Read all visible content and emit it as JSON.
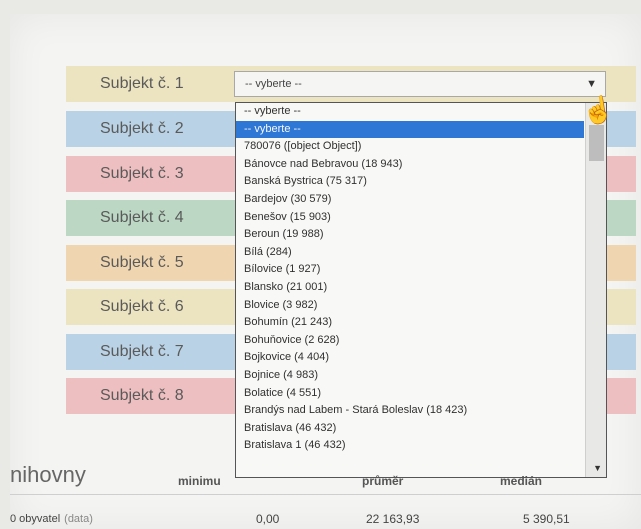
{
  "subjects": [
    {
      "label": "Subjekt č. 1",
      "color": "#ece3c0"
    },
    {
      "label": "Subjekt č. 2",
      "color": "#b9d2e5"
    },
    {
      "label": "Subjekt č. 3",
      "color": "#eebfc0"
    },
    {
      "label": "Subjekt č. 4",
      "color": "#bcd8c4"
    },
    {
      "label": "Subjekt č. 5",
      "color": "#f0d6b0"
    },
    {
      "label": "Subjekt č. 6",
      "color": "#ece3c0"
    },
    {
      "label": "Subjekt č. 7",
      "color": "#b9d2e5"
    },
    {
      "label": "Subjekt č. 8",
      "color": "#eebfc0"
    }
  ],
  "select": {
    "value": "-- vyberte --",
    "arrow_icon": "chevron-down-icon"
  },
  "dropdown": {
    "options": [
      "-- vyberte --",
      "-- vyberte --",
      "780076 ([object Object])",
      "Bánovce nad Bebravou (18 943)",
      "Banská Bystrica (75 317)",
      "Bardejov (30 579)",
      "Benešov (15 903)",
      "Beroun (19 988)",
      "Bílá (284)",
      "Bílovice (1 927)",
      "Blansko (21 001)",
      "Blovice (3 982)",
      "Bohumín (21 243)",
      "Bohuňovice (2 628)",
      "Bojkovice (4 404)",
      "Bojnice (4 983)",
      "Bolatice (4 551)",
      "Brandýs nad Labem - Stará Boleslav (18 423)",
      "Bratislava (46 432)",
      "Bratislava 1 (46 432)"
    ],
    "selected_index": 1
  },
  "stats": {
    "section_title": "nihovny",
    "columns": [
      "minimu",
      "průměr",
      "medián"
    ],
    "row_label": "0 obyvatel",
    "row_note": "(data)",
    "values": [
      "0,00",
      "22 163,93",
      "5 390,51"
    ]
  }
}
